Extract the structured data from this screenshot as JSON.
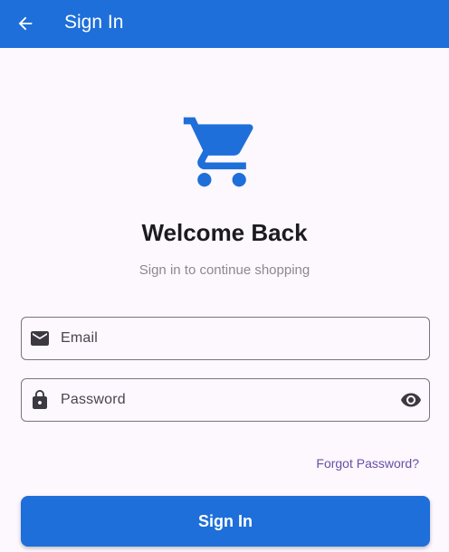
{
  "appbar": {
    "title": "Sign In",
    "back_icon": "arrow-back-icon",
    "color": "#1e6fd9"
  },
  "hero": {
    "icon": "shopping-cart-icon",
    "icon_color": "#1e6fd9",
    "title": "Welcome Back",
    "subtitle": "Sign in to continue shopping"
  },
  "form": {
    "email": {
      "placeholder": "Email",
      "value": "",
      "icon": "email-icon"
    },
    "password": {
      "placeholder": "Password",
      "value": "",
      "icon": "lock-icon",
      "toggle_icon": "visibility-icon"
    },
    "forgot_label": "Forgot Password?",
    "forgot_color": "#6750a4",
    "submit_label": "Sign In"
  }
}
